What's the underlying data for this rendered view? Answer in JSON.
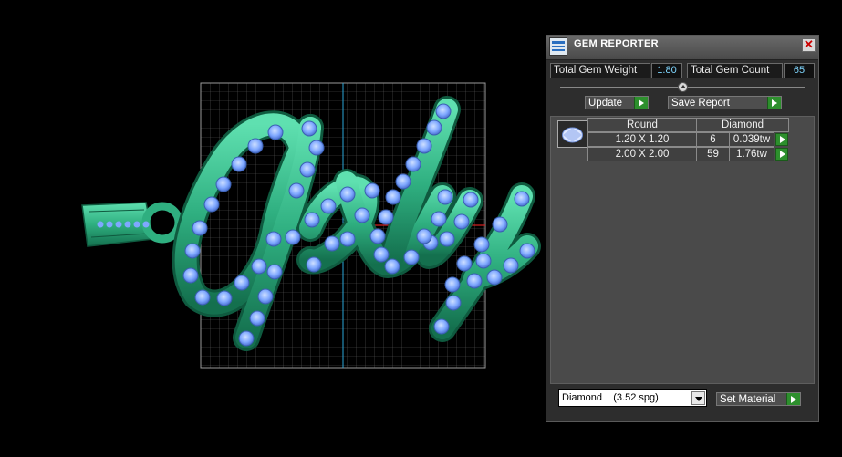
{
  "panel": {
    "title": "GEM REPORTER",
    "close_label": "✕",
    "total_weight_label": "Total Gem Weight",
    "total_weight_value": "1.80",
    "total_count_label": "Total Gem Count",
    "total_count_value": "65",
    "update_label": "Update",
    "save_report_label": "Save Report",
    "table": {
      "headers": [
        "Round",
        "Diamond"
      ],
      "rows": [
        {
          "size": "1.20 X 1.20",
          "count": "6",
          "weight": "0.039tw"
        },
        {
          "size": "2.00 X 2.00",
          "count": "59",
          "weight": "1.76tw"
        }
      ]
    },
    "material_value": "Diamond    (3.52 spg)",
    "set_material_label": "Set Material"
  },
  "colors": {
    "metal": "#2faf80",
    "gem": "#7fa8ff",
    "grid": "#777777",
    "panel_bg": "#2d2d2d",
    "button_green": "#2d8f2d",
    "value_text": "#7fd6ff"
  },
  "icons": [
    "app-icon",
    "close-icon",
    "play-icon",
    "slider-knob-icon",
    "gem-round-icon",
    "dropdown-arrow-icon"
  ]
}
